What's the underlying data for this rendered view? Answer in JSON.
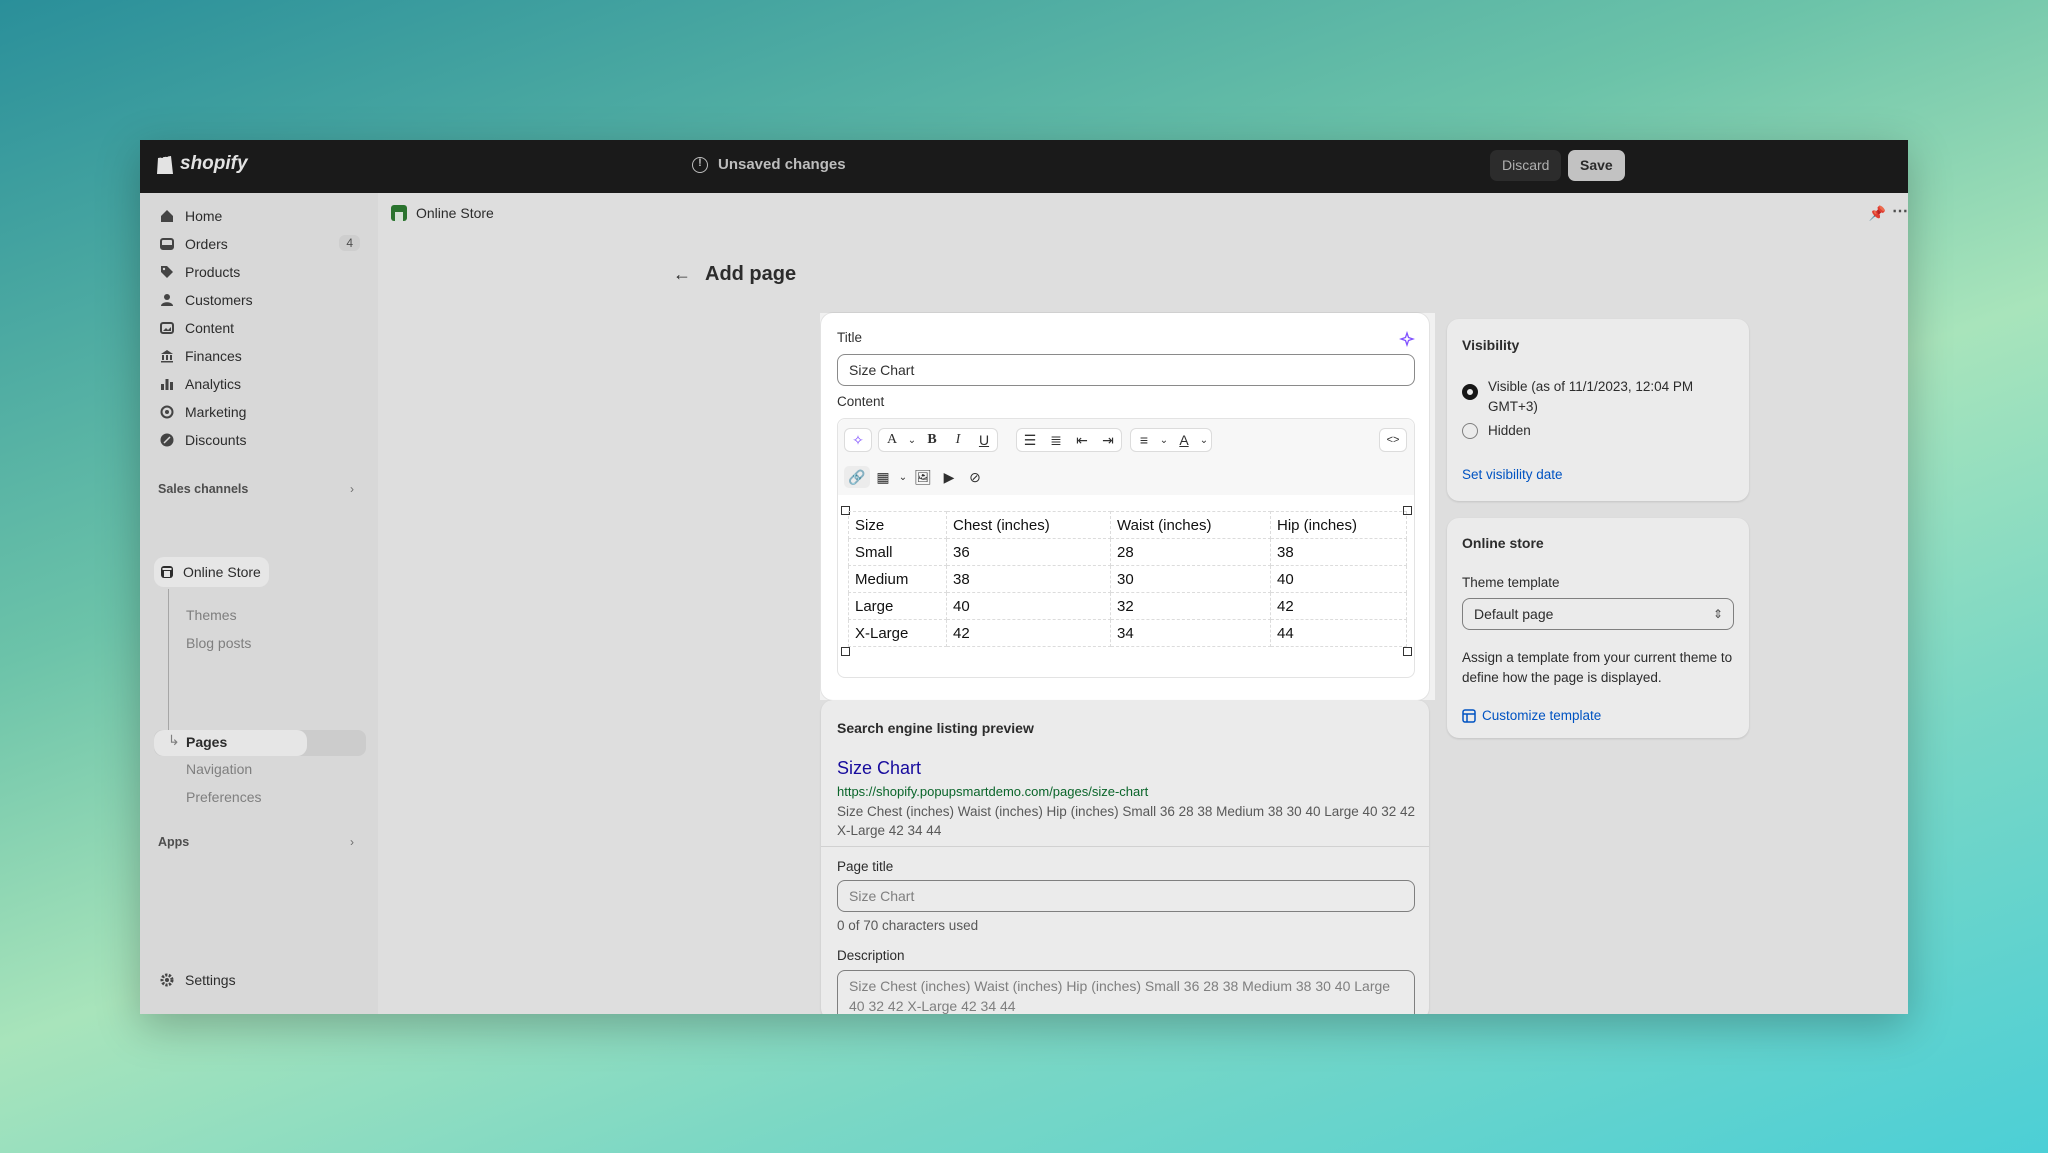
{
  "topbar": {
    "logo_text": "shopify",
    "status": "Unsaved changes",
    "discard_label": "Discard",
    "save_label": "Save"
  },
  "sidebar": {
    "items": [
      {
        "label": "Home",
        "icon": "home-icon"
      },
      {
        "label": "Orders",
        "icon": "orders-icon",
        "badge": "4"
      },
      {
        "label": "Products",
        "icon": "tag-icon"
      },
      {
        "label": "Customers",
        "icon": "person-icon"
      },
      {
        "label": "Content",
        "icon": "content-icon"
      },
      {
        "label": "Finances",
        "icon": "bank-icon"
      },
      {
        "label": "Analytics",
        "icon": "bar-chart-icon"
      },
      {
        "label": "Marketing",
        "icon": "target-icon"
      },
      {
        "label": "Discounts",
        "icon": "discount-icon"
      }
    ],
    "sales_channels_label": "Sales channels",
    "online_store_label": "Online Store",
    "sub_items": [
      "Themes",
      "Blog posts",
      "Pages",
      "Navigation",
      "Preferences"
    ],
    "apps_label": "Apps",
    "settings_label": "Settings"
  },
  "breadcrumb": {
    "label": "Online Store"
  },
  "page": {
    "title": "Add page"
  },
  "title_field": {
    "label": "Title",
    "value": "Size Chart"
  },
  "content": {
    "label": "Content",
    "table_rows": [
      [
        "Size",
        "Chest (inches)",
        "Waist (inches)",
        "Hip (inches)"
      ],
      [
        "Small",
        "36",
        "28",
        "38"
      ],
      [
        "Medium",
        "38",
        "30",
        "40"
      ],
      [
        "Large",
        "40",
        "32",
        "42"
      ],
      [
        "X-Large",
        "42",
        "34",
        "44"
      ]
    ],
    "html_toggle": "<>"
  },
  "seo": {
    "heading": "Search engine listing preview",
    "preview_title": "Size Chart",
    "preview_url": "https://shopify.popupsmartdemo.com/pages/size-chart",
    "preview_desc": "Size Chest (inches) Waist (inches) Hip (inches) Small 36 28 38 Medium 38 30 40 Large 40 32 42 X-Large 42 34 44",
    "page_title_label": "Page title",
    "page_title_placeholder": "Size Chart",
    "char_count": "0 of 70 characters used",
    "description_label": "Description",
    "description_placeholder": "Size Chest (inches) Waist (inches) Hip (inches) Small 36 28 38 Medium 38 30 40 Large 40 32 42 X-Large 42 34 44"
  },
  "visibility": {
    "heading": "Visibility",
    "visible_label": "Visible (as of 11/1/2023, 12:04 PM GMT+3)",
    "hidden_label": "Hidden",
    "set_date_link": "Set visibility date",
    "selected": "visible"
  },
  "online_store_card": {
    "heading": "Online store",
    "theme_template_label": "Theme template",
    "theme_template_value": "Default page",
    "help": "Assign a template from your current theme to define how the page is displayed.",
    "customize_link": "Customize template"
  },
  "colors": {
    "accent_link": "#005bd3",
    "topbar": "#1a1a1a",
    "ai_sparkle": "#8051ff"
  }
}
